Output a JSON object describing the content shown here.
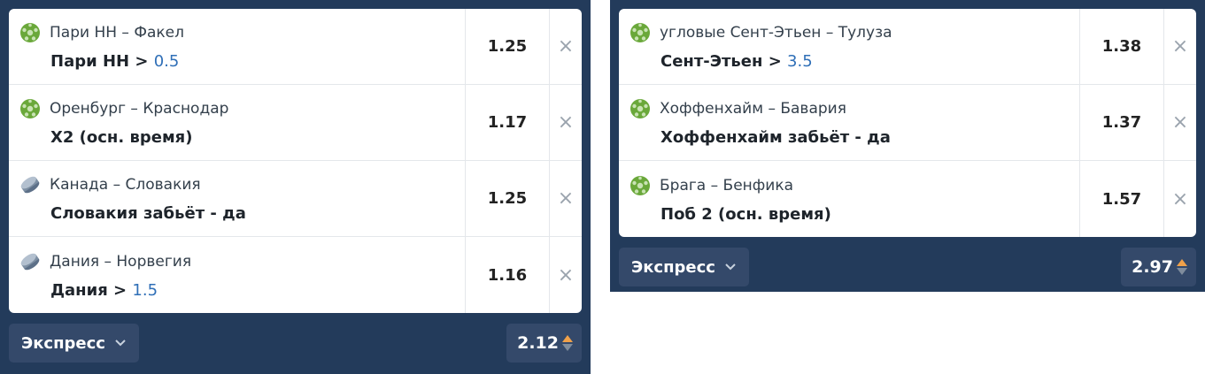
{
  "slips": [
    {
      "bets": [
        {
          "sport": "soccer-ball-icon",
          "match": "Пари НН – Факел",
          "outcome": "Пари НН > ",
          "value": "0.5",
          "odd": "1.25"
        },
        {
          "sport": "soccer-ball-icon",
          "match": "Оренбург – Краснодар",
          "outcome": "Х2 (осн. время)",
          "value": "",
          "odd": "1.17"
        },
        {
          "sport": "hockey-puck-icon",
          "match": "Канада – Словакия",
          "outcome": "Словакия забьёт - да",
          "value": "",
          "odd": "1.25"
        },
        {
          "sport": "hockey-puck-icon",
          "match": "Дания – Норвегия",
          "outcome": "Дания > ",
          "value": "1.5",
          "odd": "1.16"
        }
      ],
      "footer": {
        "type_label": "Экспресс",
        "total": "2.12"
      }
    },
    {
      "bets": [
        {
          "sport": "soccer-ball-icon",
          "match": "угловые Сент-Этьен – Тулуза",
          "outcome": "Сент-Этьен > ",
          "value": "3.5",
          "odd": "1.38"
        },
        {
          "sport": "soccer-ball-icon",
          "match": "Хоффенхайм – Бавария",
          "outcome": "Хоффенхайм забьёт - да",
          "value": "",
          "odd": "1.37"
        },
        {
          "sport": "soccer-ball-icon",
          "match": "Брага – Бенфика",
          "outcome": "Поб 2 (осн. время)",
          "value": "",
          "odd": "1.57"
        }
      ],
      "footer": {
        "type_label": "Экспресс",
        "total": "2.97"
      }
    }
  ],
  "remove_glyph": "×",
  "colors": {
    "background": "#233b5b",
    "card": "#ffffff",
    "value_blue": "#2f6fb7",
    "soccer_green": "#6aa83a",
    "hockey_gray": "#7d8fa3",
    "arrow_up": "#f0a14a"
  }
}
